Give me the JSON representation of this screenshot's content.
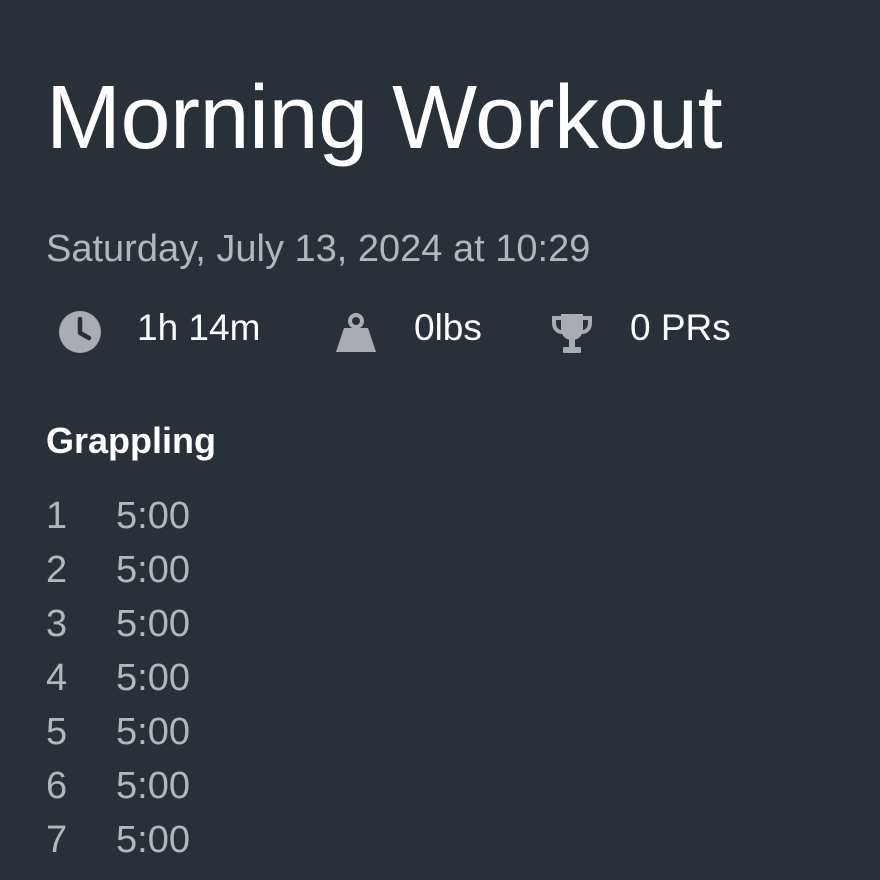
{
  "workout": {
    "title": "Morning Workout",
    "datetime": "Saturday, July 13, 2024 at 10:29"
  },
  "stats": {
    "duration": {
      "icon": "clock-icon",
      "value": "1h 14m"
    },
    "volume": {
      "icon": "weight-icon",
      "value": "0lbs"
    },
    "prs": {
      "icon": "trophy-icon",
      "value": "0 PRs"
    }
  },
  "exercise": {
    "name": "Grappling",
    "sets": [
      {
        "index": "1",
        "time": "5:00"
      },
      {
        "index": "2",
        "time": "5:00"
      },
      {
        "index": "3",
        "time": "5:00"
      },
      {
        "index": "4",
        "time": "5:00"
      },
      {
        "index": "5",
        "time": "5:00"
      },
      {
        "index": "6",
        "time": "5:00"
      },
      {
        "index": "7",
        "time": "5:00"
      }
    ]
  },
  "colors": {
    "background": "#2a3038",
    "primary_text": "#ffffff",
    "secondary_text": "#b3b6ba",
    "icon": "#a9acb0"
  }
}
